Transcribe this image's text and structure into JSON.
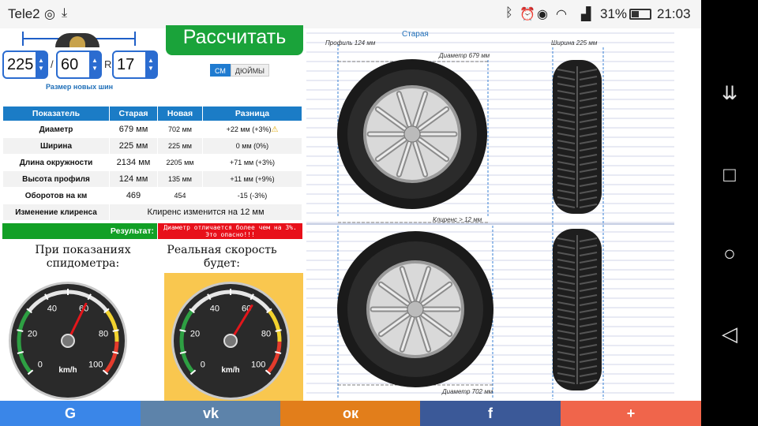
{
  "status_bar": {
    "carrier": "Tele2",
    "battery": "31%",
    "time": "21:03",
    "icons": [
      "whatsapp-icon",
      "download-icon",
      "bluetooth-icon",
      "alarm-icon",
      "eye-icon",
      "wifi-icon",
      "signal-icon",
      "battery-icon"
    ]
  },
  "inputs": {
    "width": "225",
    "profile": "60",
    "radius": "17",
    "slash": "/",
    "r_label": "R",
    "new_size_label": "Размер новых шин"
  },
  "calculate_label": "Рассчитать",
  "units": {
    "cm": "СМ",
    "inch": "ДЮЙМЫ",
    "active": "cm"
  },
  "table": {
    "headers": [
      "Показатель",
      "Старая",
      "Новая",
      "Разница"
    ],
    "rows": [
      {
        "name": "Диаметр",
        "old": "679 мм",
        "new": "702  мм",
        "diff": "+22  мм  (+3%)",
        "warn": true
      },
      {
        "name": "Ширина",
        "old": "225 мм",
        "new": "225  мм",
        "diff": "0  мм  (0%)"
      },
      {
        "name": "Длина окружности",
        "old": "2134 мм",
        "new": "2205  мм",
        "diff": "+71  мм  (+3%)"
      },
      {
        "name": "Высота профиля",
        "old": "124 мм",
        "new": "135  мм",
        "diff": "+11  мм  (+9%)"
      },
      {
        "name": "Оборотов на км",
        "old": "469",
        "new": "454",
        "diff": "-15  (-3%)"
      }
    ],
    "clearance_label": "Изменение клиренса",
    "clearance_value": "Клиренс изменится на 12 мм",
    "result_label": "Результат:",
    "result_message": "Диаметр отличается более чем на 3%. Это опасно!!!"
  },
  "speedometer": {
    "left_caption": "При показаниях спидометра:",
    "right_caption": "Реальная скорость будет:",
    "unit": "km/h",
    "ticks": [
      "0",
      "10",
      "20",
      "30",
      "40",
      "50",
      "60",
      "70",
      "80",
      "90",
      "100"
    ],
    "left_value": 60,
    "right_value": 62,
    "max": 100
  },
  "diagram": {
    "old_title": "Старая",
    "old_profile": "Профиль 124 мм",
    "old_width": "Ширина 225 мм",
    "old_diameter": "Диаметр 679 мм",
    "clearance": "Клиренс > 12 мм",
    "new_diameter": "Диаметр 702 мм"
  },
  "share": [
    {
      "icon": "google-icon",
      "glyph": "G",
      "color": "#3a86e8"
    },
    {
      "icon": "vk-icon",
      "glyph": "vk",
      "color": "#5d83aa"
    },
    {
      "icon": "odnoklassniki-icon",
      "glyph": "ок",
      "color": "#e27e1b"
    },
    {
      "icon": "facebook-icon",
      "glyph": "f",
      "color": "#3b5998"
    },
    {
      "icon": "plus-icon",
      "glyph": "+",
      "color": "#f0654b"
    }
  ]
}
